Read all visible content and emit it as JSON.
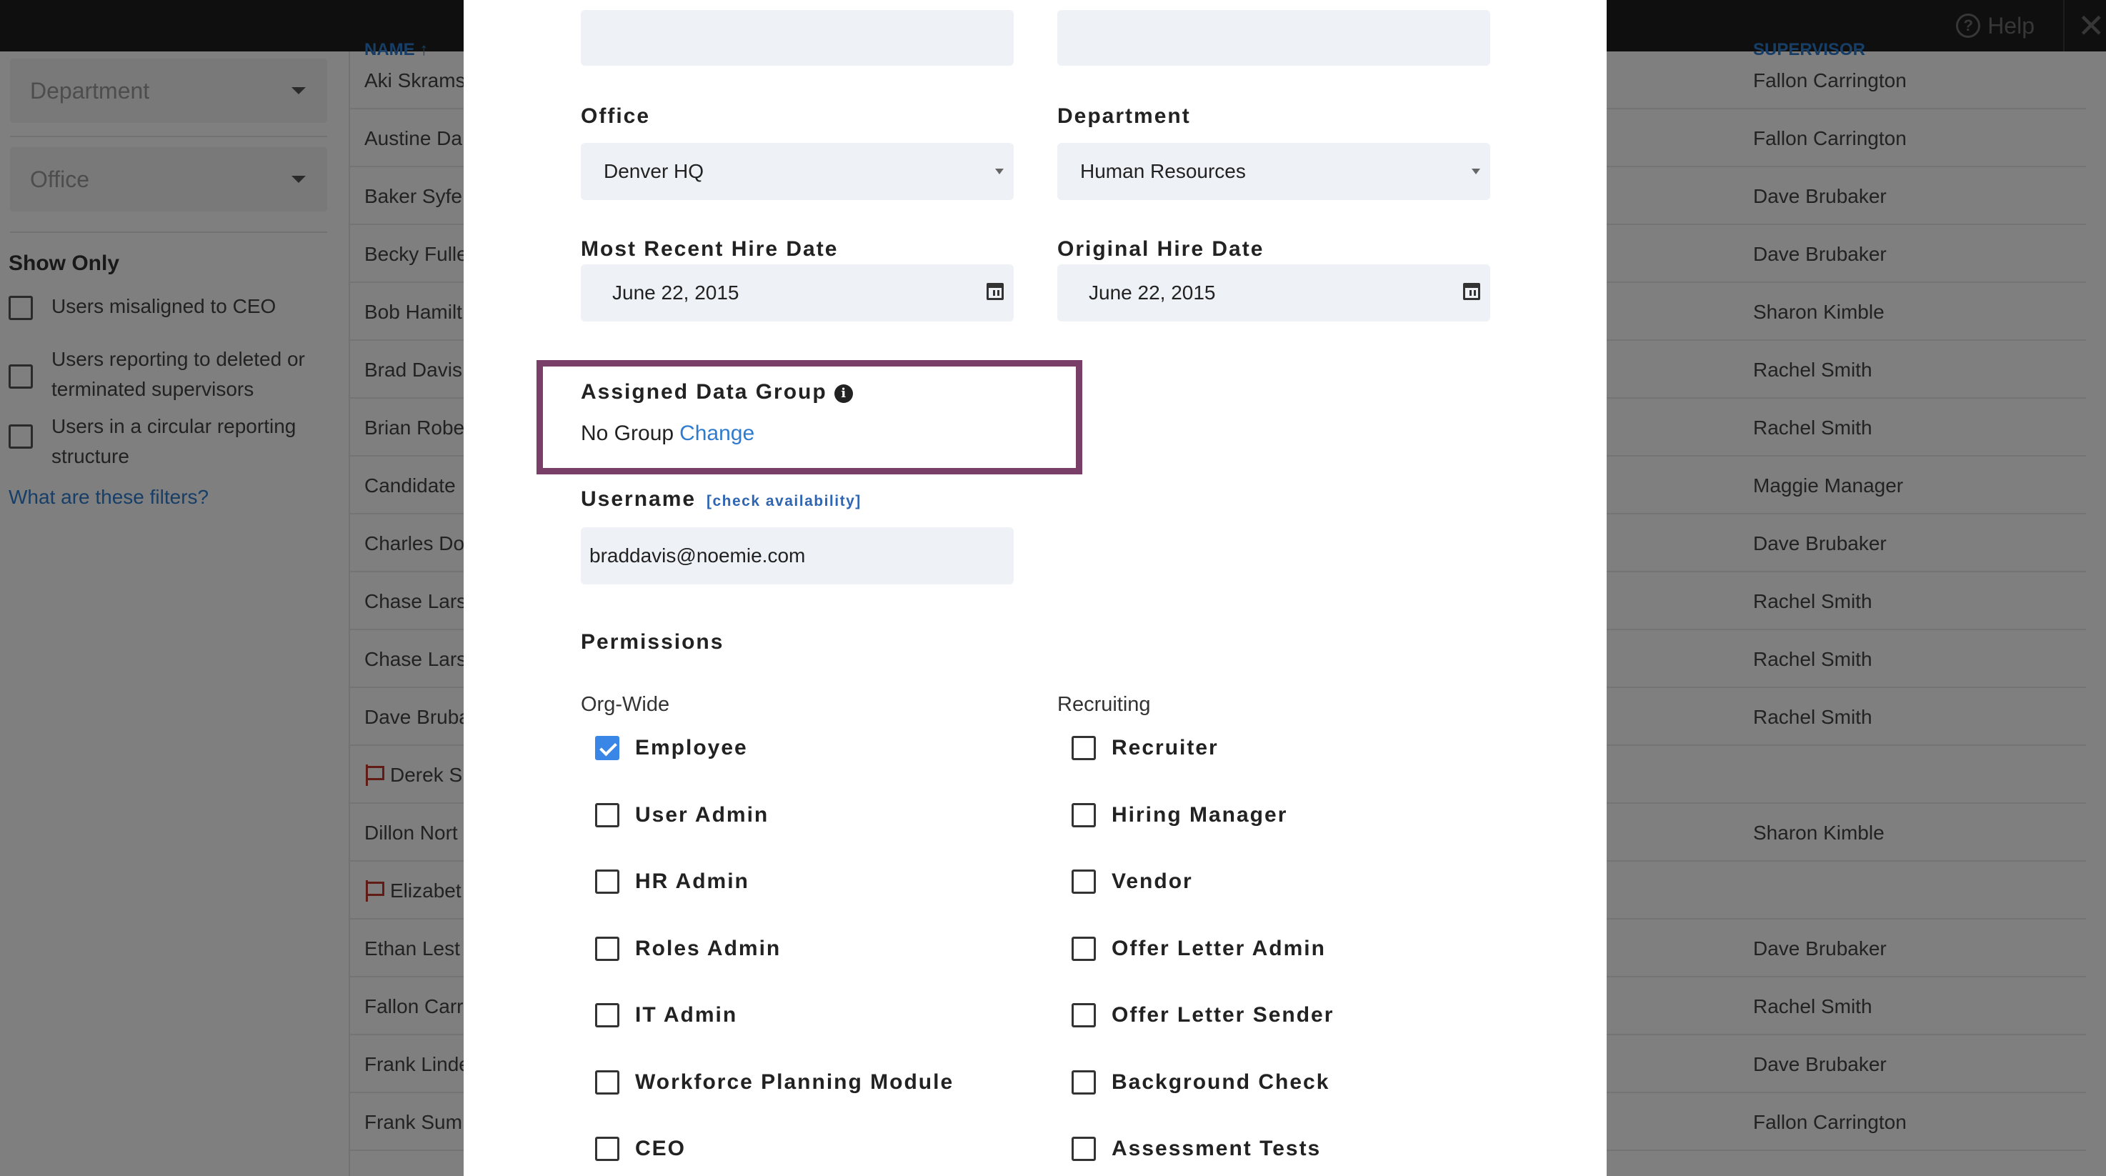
{
  "topbar": {
    "help_label": "Help",
    "help_icon": "question-circle-icon",
    "close_icon": "close-x-icon"
  },
  "sidebar": {
    "department_placeholder": "Department",
    "office_placeholder": "Office",
    "show_only_title": "Show Only",
    "filters": [
      {
        "label": "Users misaligned to CEO",
        "checked": false
      },
      {
        "label": "Users reporting to deleted or terminated supervisors",
        "checked": false
      },
      {
        "label": "Users in a circular reporting structure",
        "checked": false
      }
    ],
    "help_link": "What are these filters?"
  },
  "table": {
    "rows": [
      {
        "name": "Aki Skrams",
        "supervisor": "Fallon Carrington",
        "flagged": false
      },
      {
        "name": "Austine Da",
        "supervisor": "Fallon Carrington",
        "flagged": false
      },
      {
        "name": "Baker Syfe",
        "supervisor": "Dave Brubaker",
        "flagged": false
      },
      {
        "name": "Becky Fulle",
        "supervisor": "Dave Brubaker",
        "flagged": false
      },
      {
        "name": "Bob Hamilt",
        "supervisor": "Sharon Kimble",
        "flagged": false
      },
      {
        "name": "Brad Davis",
        "supervisor": "Rachel Smith",
        "flagged": false
      },
      {
        "name": "Brian Robe",
        "supervisor": "Rachel Smith",
        "flagged": false
      },
      {
        "name": "Candidate",
        "supervisor": "Maggie Manager",
        "flagged": false
      },
      {
        "name": "Charles Do",
        "supervisor": "Dave Brubaker",
        "flagged": false
      },
      {
        "name": "Chase Lars",
        "supervisor": "Rachel Smith",
        "flagged": false
      },
      {
        "name": "Chase Lars",
        "supervisor": "Rachel Smith",
        "flagged": false
      },
      {
        "name": "Dave Bruba",
        "supervisor": "Rachel Smith",
        "flagged": false
      },
      {
        "name": "Derek Sl",
        "supervisor": "",
        "flagged": true
      },
      {
        "name": "Dillon Nort",
        "supervisor": "Sharon Kimble",
        "flagged": false
      },
      {
        "name": "Elizabet",
        "supervisor": "",
        "flagged": true
      },
      {
        "name": "Ethan Lest",
        "supervisor": "Dave Brubaker",
        "flagged": false
      },
      {
        "name": "Fallon Carr",
        "supervisor": "Rachel Smith",
        "flagged": false
      },
      {
        "name": "Frank Linde",
        "supervisor": "Dave Brubaker",
        "flagged": false
      },
      {
        "name": "Frank Sum",
        "supervisor": "Fallon Carrington",
        "flagged": false
      }
    ]
  },
  "modal": {
    "office": {
      "label": "Office",
      "value": "Denver HQ"
    },
    "department": {
      "label": "Department",
      "value": "Human Resources"
    },
    "most_recent_hire_date": {
      "label": "Most Recent Hire Date",
      "value": "June 22, 2015"
    },
    "original_hire_date": {
      "label": "Original Hire Date",
      "value": "June 22, 2015"
    },
    "data_group": {
      "label": "Assigned Data Group",
      "value": "No Group",
      "change_label": "Change",
      "highlight_color": "#7a3f68"
    },
    "username": {
      "label": "Username",
      "check_label": "[check availability]",
      "value": "braddavis@noemie.com"
    },
    "permissions": {
      "title": "Permissions",
      "org_wide": {
        "title": "Org-Wide",
        "items": [
          {
            "label": "Employee",
            "checked": true
          },
          {
            "label": "User Admin",
            "checked": false
          },
          {
            "label": "HR Admin",
            "checked": false
          },
          {
            "label": "Roles Admin",
            "checked": false
          },
          {
            "label": "IT Admin",
            "checked": false
          },
          {
            "label": "Workforce Planning Module",
            "checked": false
          },
          {
            "label": "CEO",
            "checked": false
          }
        ]
      },
      "recruiting": {
        "title": "Recruiting",
        "items": [
          {
            "label": "Recruiter",
            "checked": false
          },
          {
            "label": "Hiring Manager",
            "checked": false
          },
          {
            "label": "Vendor",
            "checked": false
          },
          {
            "label": "Offer Letter Admin",
            "checked": false
          },
          {
            "label": "Offer Letter Sender",
            "checked": false
          },
          {
            "label": "Background Check",
            "checked": false
          },
          {
            "label": "Assessment Tests",
            "checked": false
          }
        ]
      }
    }
  },
  "colors": {
    "accent": "#3a86e6",
    "link": "#2f7ccf",
    "topbar": "#1e1e1e"
  }
}
